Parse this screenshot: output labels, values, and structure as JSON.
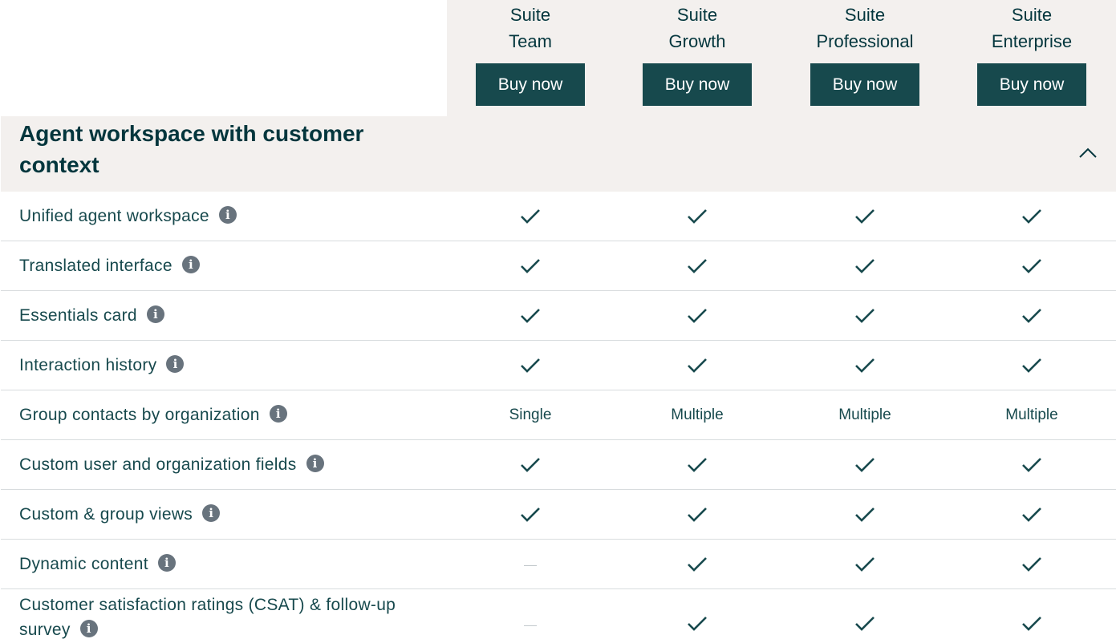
{
  "plans": [
    {
      "line1": "Suite",
      "line2": "Team",
      "button": "Buy now"
    },
    {
      "line1": "Suite",
      "line2": "Growth",
      "button": "Buy now"
    },
    {
      "line1": "Suite",
      "line2": "Professional",
      "button": "Buy now"
    },
    {
      "line1": "Suite",
      "line2": "Enterprise",
      "button": "Buy now"
    }
  ],
  "section": {
    "title": "Agent workspace with customer context",
    "toggle_icon": "chevron-up-icon"
  },
  "features": [
    {
      "label": "Unified agent workspace",
      "values": [
        "check",
        "check",
        "check",
        "check"
      ]
    },
    {
      "label": "Translated interface",
      "values": [
        "check",
        "check",
        "check",
        "check"
      ]
    },
    {
      "label": "Essentials card",
      "values": [
        "check",
        "check",
        "check",
        "check"
      ]
    },
    {
      "label": "Interaction history",
      "values": [
        "check",
        "check",
        "check",
        "check"
      ]
    },
    {
      "label": "Group contacts by organization",
      "values": [
        "Single",
        "Multiple",
        "Multiple",
        "Multiple"
      ]
    },
    {
      "label": "Custom user and organization fields",
      "values": [
        "check",
        "check",
        "check",
        "check"
      ]
    },
    {
      "label": "Custom & group views",
      "values": [
        "check",
        "check",
        "check",
        "check"
      ]
    },
    {
      "label": "Dynamic content",
      "values": [
        "dash",
        "check",
        "check",
        "check"
      ]
    },
    {
      "label": "Customer satisfaction ratings (CSAT) & follow-up survey",
      "values": [
        "dash",
        "check",
        "check",
        "check"
      ]
    }
  ],
  "info_icon_glyph": "i",
  "colors": {
    "brand_dark": "#17494d",
    "header_bg": "#f3f0ee",
    "info_icon": "#68737d",
    "divider": "#d8dcde"
  }
}
